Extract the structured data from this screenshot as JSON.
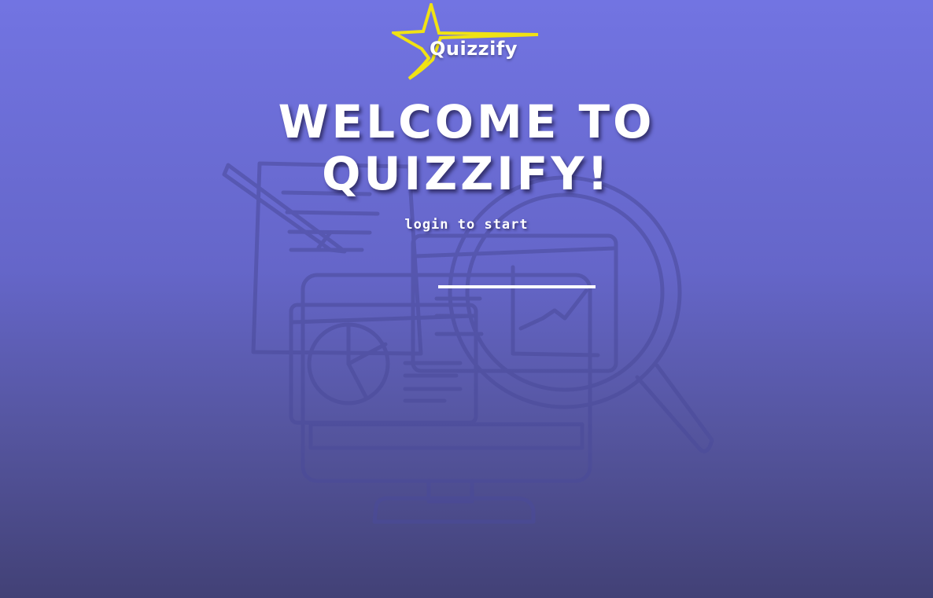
{
  "logo": {
    "icon": "star-icon",
    "text": "Quizzify",
    "star_color": "#f0e214"
  },
  "hero": {
    "headline": "WELCOME TO QUIZZIFY!",
    "subtitle": "login to start"
  },
  "login": {
    "underline_color": "#ffffff"
  },
  "colors": {
    "background_top": "#7274e2",
    "background_bottom": "#424176",
    "text": "#ffffff"
  }
}
